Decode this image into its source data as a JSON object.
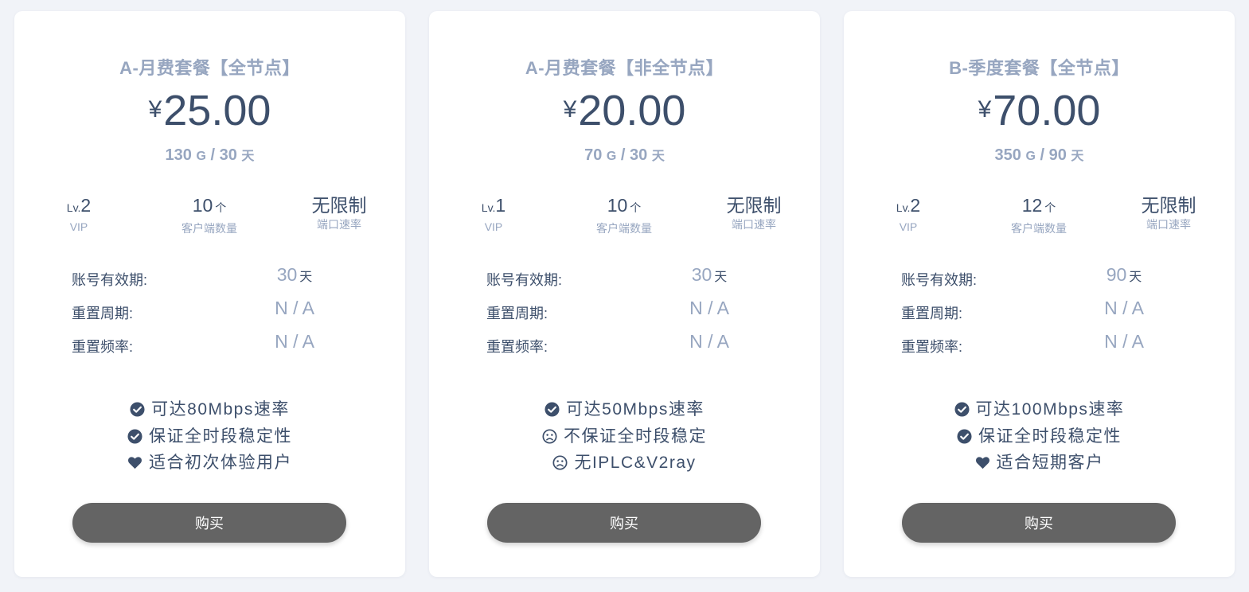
{
  "colors": {
    "accent": "#97a6c0",
    "text": "#3d4f6b",
    "button": "#646464",
    "background": "#f1f3f8"
  },
  "plans": [
    {
      "title": "A-月费套餐【全节点】",
      "currency": "¥",
      "price": "25.00",
      "quota_amount": "130",
      "quota_unit": "G",
      "quota_sep": " / ",
      "quota_days": "30",
      "quota_day_unit": "天",
      "stats": {
        "level_prefix": "Lv.",
        "level": "2",
        "level_label": "VIP",
        "clients": "10",
        "clients_unit": "个",
        "clients_label": "客户端数量",
        "speed": "无限制",
        "speed_label": "端口速率"
      },
      "details": {
        "validity_label": "账号有效期:",
        "validity": "30",
        "validity_unit": "天",
        "reset_period_label": "重置周期:",
        "reset_period": "N / A",
        "reset_freq_label": "重置频率:",
        "reset_freq": "N / A"
      },
      "features": [
        {
          "icon": "check-circle-icon",
          "text": "可达80Mbps速率"
        },
        {
          "icon": "check-circle-icon",
          "text": "保证全时段稳定性"
        },
        {
          "icon": "heart-icon",
          "text": "适合初次体验用户"
        }
      ],
      "buy_label": "购买"
    },
    {
      "title": "A-月费套餐【非全节点】",
      "currency": "¥",
      "price": "20.00",
      "quota_amount": "70",
      "quota_unit": "G",
      "quota_sep": " / ",
      "quota_days": "30",
      "quota_day_unit": "天",
      "stats": {
        "level_prefix": "Lv.",
        "level": "1",
        "level_label": "VIP",
        "clients": "10",
        "clients_unit": "个",
        "clients_label": "客户端数量",
        "speed": "无限制",
        "speed_label": "端口速率"
      },
      "details": {
        "validity_label": "账号有效期:",
        "validity": "30",
        "validity_unit": "天",
        "reset_period_label": "重置周期:",
        "reset_period": "N / A",
        "reset_freq_label": "重置频率:",
        "reset_freq": "N / A"
      },
      "features": [
        {
          "icon": "check-circle-icon",
          "text": "可达50Mbps速率"
        },
        {
          "icon": "frown-icon",
          "text": "不保证全时段稳定"
        },
        {
          "icon": "frown-icon",
          "text": "无IPLC&V2ray"
        }
      ],
      "buy_label": "购买"
    },
    {
      "title": "B-季度套餐【全节点】",
      "currency": "¥",
      "price": "70.00",
      "quota_amount": "350",
      "quota_unit": "G",
      "quota_sep": " / ",
      "quota_days": "90",
      "quota_day_unit": "天",
      "stats": {
        "level_prefix": "Lv.",
        "level": "2",
        "level_label": "VIP",
        "clients": "12",
        "clients_unit": "个",
        "clients_label": "客户端数量",
        "speed": "无限制",
        "speed_label": "端口速率"
      },
      "details": {
        "validity_label": "账号有效期:",
        "validity": "90",
        "validity_unit": "天",
        "reset_period_label": "重置周期:",
        "reset_period": "N / A",
        "reset_freq_label": "重置频率:",
        "reset_freq": "N / A"
      },
      "features": [
        {
          "icon": "check-circle-icon",
          "text": "可达100Mbps速率"
        },
        {
          "icon": "check-circle-icon",
          "text": "保证全时段稳定性"
        },
        {
          "icon": "heart-icon",
          "text": "适合短期客户"
        }
      ],
      "buy_label": "购买"
    }
  ]
}
